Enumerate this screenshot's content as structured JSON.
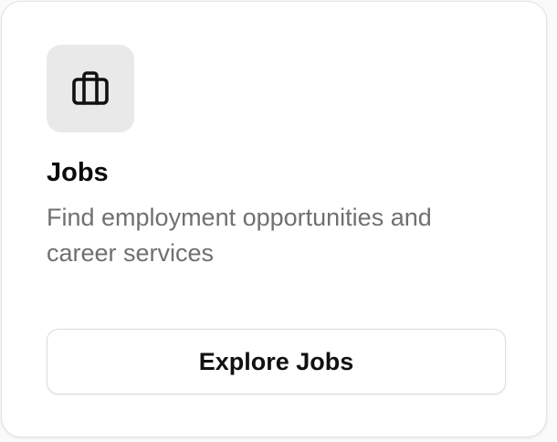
{
  "card": {
    "icon": "briefcase-icon",
    "title": "Jobs",
    "description": "Find employment opportunities and career services",
    "button_label": "Explore Jobs"
  },
  "colors": {
    "icon_tile_bg": "#e9e9e9",
    "title": "#0b0b0b",
    "description": "#707070",
    "border": "#dcdcdc"
  }
}
